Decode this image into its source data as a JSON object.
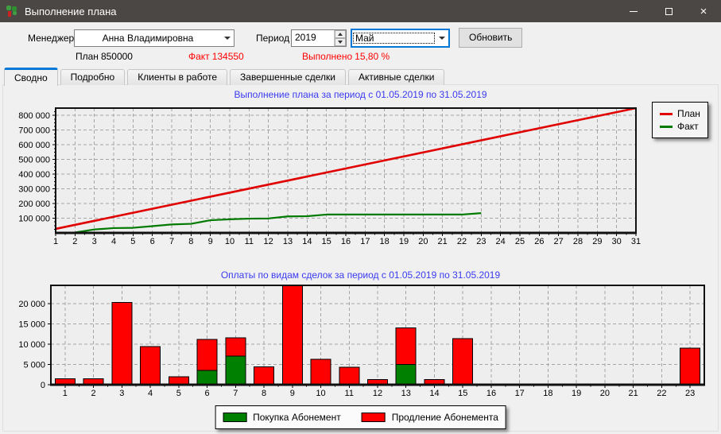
{
  "titlebar": {
    "title": "Выполнение плана",
    "close_glyph": "×",
    "icons": {
      "app": "app-icon",
      "minimize": "minimize-icon",
      "maximize": "maximize-icon",
      "close": "close-icon"
    }
  },
  "toolbar": {
    "manager_label": "Менеджер",
    "manager_value": "Анна Владимировна",
    "period_label": "Период",
    "year_value": "2019",
    "month_value": "Май",
    "refresh_button": "Обновить"
  },
  "summary": {
    "plan_label": "План",
    "plan_value": "850000",
    "fact_label": "Факт",
    "fact_value": "134550",
    "completed_label": "Выполнено",
    "completed_value": "15,80 %"
  },
  "tabs": [
    {
      "label": "Сводно",
      "active": true
    },
    {
      "label": "Подробно",
      "active": false
    },
    {
      "label": "Клиенты в работе",
      "active": false
    },
    {
      "label": "Завершенные сделки",
      "active": false
    },
    {
      "label": "Активные сделки",
      "active": false
    }
  ],
  "colors": {
    "accent": "#0078d7",
    "titlebar_bg": "#4a4745",
    "chart_title_blue": "#3a3af0",
    "alert_red": "#ff0000",
    "plan_line": "#e00000",
    "fact_line": "#007a00",
    "bar_green": "#008000",
    "bar_red": "#ff0000",
    "grid": "#a6a6a6"
  },
  "chart_data": [
    {
      "type": "line",
      "title": "Выполнение плана за период с 01.05.2019 по 31.05.2019",
      "xlabel": "",
      "ylabel": "",
      "x_ticks": [
        1,
        2,
        3,
        4,
        5,
        6,
        7,
        8,
        9,
        10,
        11,
        12,
        13,
        14,
        15,
        16,
        17,
        18,
        19,
        20,
        21,
        22,
        23,
        24,
        25,
        26,
        27,
        28,
        29,
        30,
        31
      ],
      "ylim": [
        0,
        850000
      ],
      "y_tick_values": [
        100000,
        200000,
        300000,
        400000,
        500000,
        600000,
        700000,
        800000
      ],
      "y_tick_labels": [
        "100 000",
        "200 000",
        "300 000",
        "400 000",
        "500 000",
        "600 000",
        "700 000",
        "800 000"
      ],
      "grid": true,
      "legend_position": "top-right",
      "series": [
        {
          "name": "План",
          "color": "#e00000",
          "x": [
            1,
            31
          ],
          "y": [
            27419,
            850000
          ]
        },
        {
          "name": "Факт",
          "color": "#007a00",
          "x": [
            1,
            2,
            3,
            4,
            5,
            6,
            7,
            8,
            9,
            10,
            11,
            12,
            13,
            14,
            15,
            16,
            17,
            18,
            19,
            20,
            21,
            22,
            23
          ],
          "y": [
            1500,
            3000,
            23300,
            32700,
            34700,
            45900,
            57500,
            61900,
            86400,
            92700,
            97000,
            98300,
            112300,
            113600,
            125000,
            125000,
            125000,
            125000,
            125000,
            125000,
            125000,
            125000,
            134550
          ]
        }
      ]
    },
    {
      "type": "bar",
      "stacked": true,
      "title": "Оплаты по видам сделок за период с 01.05.2019 по 31.05.2019",
      "xlabel": "",
      "ylabel": "",
      "categories": [
        1,
        2,
        3,
        4,
        5,
        6,
        7,
        8,
        9,
        10,
        11,
        12,
        13,
        14,
        15,
        16,
        17,
        18,
        19,
        20,
        21,
        22,
        23
      ],
      "ylim": [
        0,
        24500
      ],
      "y_tick_values": [
        0,
        5000,
        10000,
        15000,
        20000
      ],
      "y_tick_labels": [
        "0",
        "5 000",
        "10 000",
        "15 000",
        "20 000"
      ],
      "grid": true,
      "legend_position": "bottom-center",
      "series": [
        {
          "name": "Покупка Абонемент",
          "color": "#008000",
          "values": [
            0,
            0,
            0,
            0,
            0,
            3500,
            7100,
            0,
            0,
            0,
            0,
            0,
            5000,
            0,
            0,
            0,
            0,
            0,
            0,
            0,
            0,
            0,
            0
          ]
        },
        {
          "name": "Продление Абонемента",
          "color": "#ff0000",
          "values": [
            1500,
            1500,
            20300,
            9400,
            2000,
            7700,
            4500,
            4400,
            24500,
            6300,
            4300,
            1300,
            9000,
            1300,
            11400,
            0,
            0,
            0,
            0,
            0,
            0,
            0,
            9000
          ]
        }
      ]
    }
  ]
}
